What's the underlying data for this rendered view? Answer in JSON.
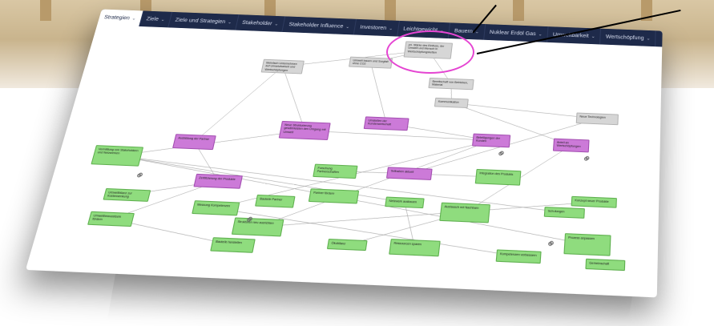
{
  "tabs": [
    {
      "label": "Strategien",
      "active": true
    },
    {
      "label": "Ziele",
      "active": false
    },
    {
      "label": "Ziele und Strategien",
      "active": false
    },
    {
      "label": "Stakeholder",
      "active": false
    },
    {
      "label": "Stakeholder Influence",
      "active": false
    },
    {
      "label": "Investoren",
      "active": false
    },
    {
      "label": "Leichtgewicht",
      "active": false
    },
    {
      "label": "Bauern",
      "active": false
    },
    {
      "label": "Nuklear Erdöl Gas",
      "active": false
    },
    {
      "label": "Umweltbarkeit",
      "active": false
    },
    {
      "label": "Wertschöpfung",
      "active": false
    }
  ],
  "nodes": {
    "top_callout_text": "pri. Stärke des Einfluss, der Umwelt und Mensch in Wertschöpfungsketten",
    "gray_1": "Mehrfach Unternehmen auf Umsetzbarkeit und Wertschöpfungen",
    "gray_2": "Umwelt bauen und Sorgfalt ohne CO2",
    "gray_3": "Bereitschaft von Betrieben, Material",
    "gray_4": "Kommunikation",
    "gray_5": "Neue Technologien",
    "purple_1": "Ausbildung der Partner",
    "purple_2": "Neue Strukturierung gewährleisten den Umgang mit Umwelt",
    "purple_3": "Umstellen der Kundenwirtschaft",
    "purple_4": "Zertifizierung der Produkte",
    "purple_5": "Beteiligungen der Kunden",
    "purple_6": "Anteil an Wertschöpfungen",
    "purple_7": "Teilhaben aktuell",
    "green_1": "Vermittlung von Stakeholdern und Netzwerken",
    "green_2": "Umweltbilanz zur Kostensenkung",
    "green_3": "Umweltbewusstsein fördern",
    "green_4": "Messung Kompetenzen",
    "green_5": "Strukturen neu ausrichten",
    "green_6": "Forschung Partnerschaften",
    "green_7": "Partner fördern",
    "green_8": "Netzwerk ausbauen",
    "green_9": "Austausch mit Nachbarn",
    "green_10": "Integration des Produkts",
    "green_11": "Schulungen",
    "green_12": "Prozess anpassen",
    "green_13": "Ressourcen sparen",
    "green_14": "Ökobilanz",
    "green_15": "Bauteile herstellen",
    "green_16": "Kompetenzen verbessern",
    "green_17": "Konzept neuer Produkte",
    "green_18": "Bauteile Partner",
    "green_19": "Gemeinschaft"
  },
  "colors": {
    "tabbar": "#1e2a4a",
    "green_node": "#8fdc7e",
    "purple_node": "#cc7ad8",
    "gray_node": "#d6d6d6",
    "callout": "#e545d2"
  }
}
